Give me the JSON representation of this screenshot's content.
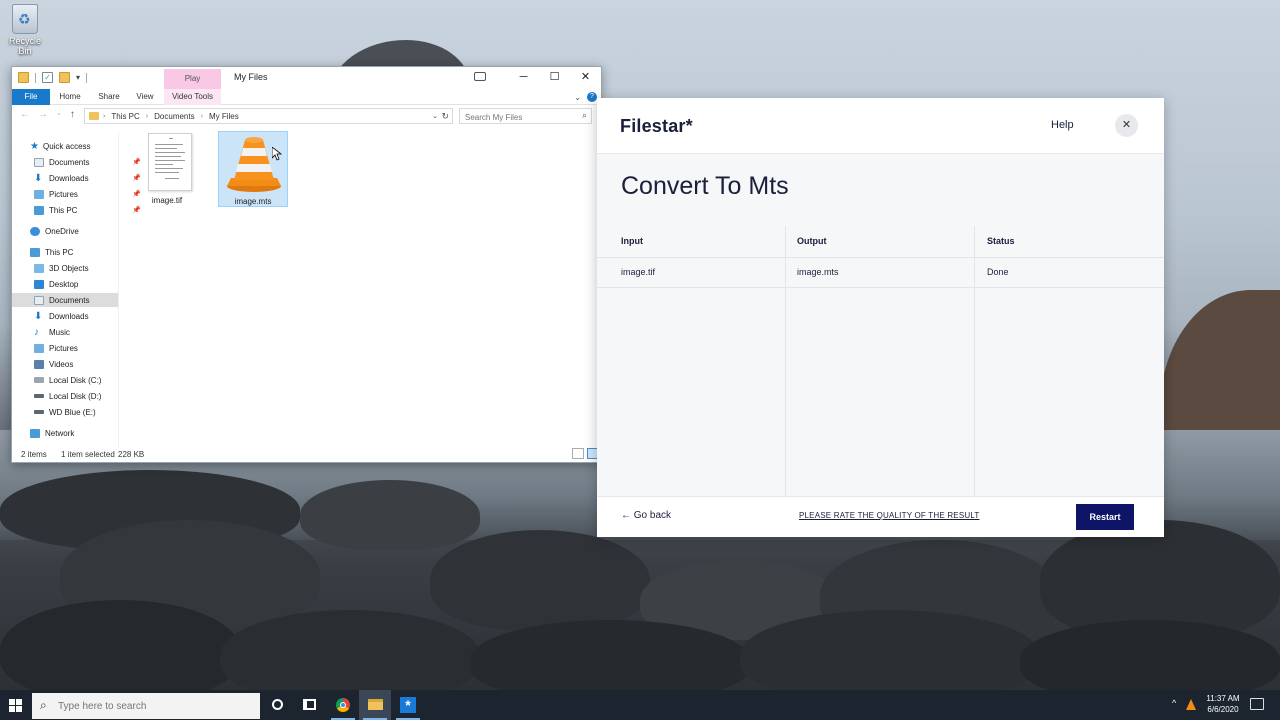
{
  "desktop": {
    "recycle_bin_label": "Recycle Bin"
  },
  "explorer": {
    "window_title": "My Files",
    "context_tab_group": "Play",
    "ribbon_tabs": [
      "File",
      "Home",
      "Share",
      "View",
      "Video Tools"
    ],
    "breadcrumb": [
      "This PC",
      "Documents",
      "My Files"
    ],
    "search_placeholder": "Search My Files",
    "nav": {
      "quick_access": "Quick access",
      "qa_documents": "Documents",
      "qa_downloads": "Downloads",
      "qa_pictures": "Pictures",
      "qa_this_pc": "This PC",
      "onedrive": "OneDrive",
      "this_pc": "This PC",
      "objects_3d": "3D Objects",
      "desktop": "Desktop",
      "documents": "Documents",
      "downloads": "Downloads",
      "music": "Music",
      "pictures": "Pictures",
      "videos": "Videos",
      "local_c": "Local Disk (C:)",
      "local_d": "Local Disk (D:)",
      "wd_blue": "WD Blue (E:)",
      "network": "Network"
    },
    "files": [
      {
        "name": "image.tif",
        "selected": false
      },
      {
        "name": "image.mts",
        "selected": true
      }
    ],
    "status": {
      "item_count": "2 items",
      "selection": "1 item selected",
      "size": "228 KB"
    }
  },
  "filestar": {
    "logo": "Filestar*",
    "help": "Help",
    "title": "Convert To Mts",
    "columns": {
      "input": "Input",
      "output": "Output",
      "status": "Status"
    },
    "rows": [
      {
        "input": "image.tif",
        "output": "image.mts",
        "status": "Done"
      }
    ],
    "go_back": "Go back",
    "rate_link": "PLEASE RATE THE QUALITY OF THE RESULT",
    "restart": "Restart"
  },
  "taskbar": {
    "search_placeholder": "Type here to search",
    "time": "11:37 AM",
    "date": "6/6/2020"
  },
  "colors": {
    "explorer_accent": "#1979ca",
    "filestar_button": "#0e1466",
    "filestar_text": "#1a1f3a"
  }
}
